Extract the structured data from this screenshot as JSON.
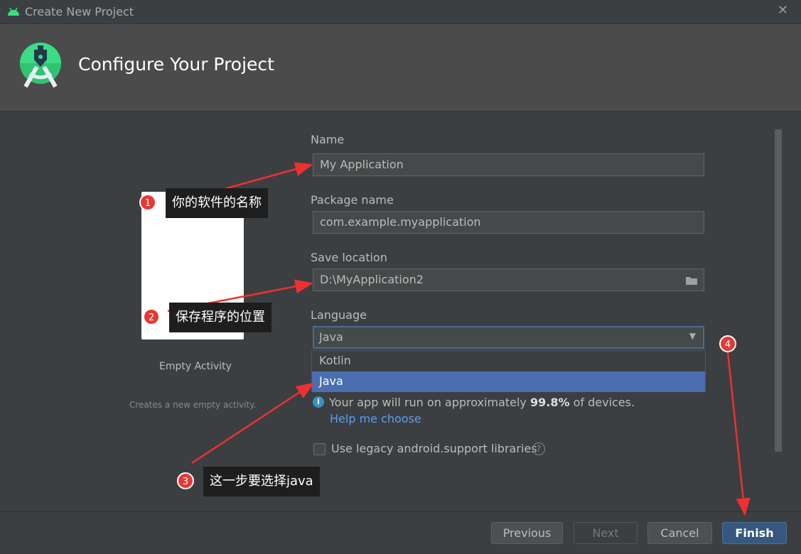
{
  "window": {
    "title": "Create New Project",
    "close": "✕"
  },
  "header": {
    "title": "Configure Your Project"
  },
  "template": {
    "name": "Empty Activity",
    "description": "Creates a new empty activity."
  },
  "form": {
    "name_label": "Name",
    "name_value": "My Application",
    "package_label": "Package name",
    "package_value": "com.example.myapplication",
    "location_label": "Save location",
    "location_value": "D:\\MyApplication2",
    "language_label": "Language",
    "language_value": "Java",
    "language_options": [
      "Kotlin",
      "Java"
    ],
    "info_prefix": "Your app will run on approximately ",
    "info_percent": "99.8%",
    "info_suffix": " of devices.",
    "help_link": "Help me choose",
    "legacy_label": "Use legacy android.support libraries",
    "legacy_checked": false
  },
  "buttons": {
    "previous": "Previous",
    "next": "Next",
    "cancel": "Cancel",
    "finish": "Finish"
  },
  "annotations": [
    {
      "n": "1",
      "text": "你的软件的名称"
    },
    {
      "n": "2",
      "text": "保存程序的位置"
    },
    {
      "n": "3",
      "text": "这一步要选择java"
    },
    {
      "n": "4"
    }
  ],
  "colors": {
    "accent": "#4b6eaf",
    "primary_button": "#365880",
    "annotation": "#e53935",
    "android_green": "#3ddc84"
  }
}
